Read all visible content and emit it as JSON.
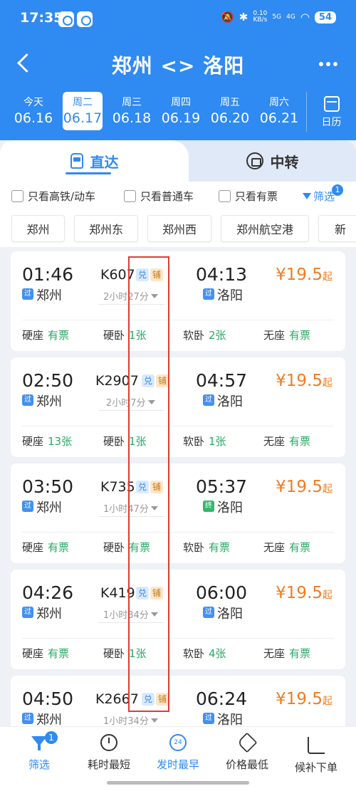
{
  "status_bar": {
    "time": "17:35",
    "net_speed": "0.10",
    "net_unit": "KB/s",
    "sig1": "5G",
    "sig2": "4G",
    "battery": "54"
  },
  "header": {
    "route": "郑州 <> 洛阳"
  },
  "dates": [
    {
      "dow": "今天",
      "date": "06.16"
    },
    {
      "dow": "周二",
      "date": "06.17"
    },
    {
      "dow": "周三",
      "date": "06.18"
    },
    {
      "dow": "周四",
      "date": "06.19"
    },
    {
      "dow": "周五",
      "date": "06.20"
    },
    {
      "dow": "周六",
      "date": "06.21"
    }
  ],
  "calendar_label": "日历",
  "tabs": {
    "direct": "直达",
    "transfer": "中转"
  },
  "filters": {
    "highspeed": "只看高铁/动车",
    "normal": "只看普通车",
    "available": "只看有票",
    "screen": "筛选",
    "screen_badge": "1"
  },
  "stations": [
    "郑州",
    "郑州东",
    "郑州西",
    "郑州航空港",
    "新"
  ],
  "trains": [
    {
      "dep_time": "01:46",
      "dep_tag": "过",
      "dep_station": "郑州",
      "train_no": "K607",
      "badge1": "兑",
      "badge2": "铺",
      "duration": "2小时27分",
      "arr_time": "04:13",
      "arr_tag": "过",
      "arr_station": "洛阳",
      "price_currency": "¥",
      "price": "19.5",
      "price_suffix": "起",
      "seats": [
        {
          "name": "硬座",
          "avail": "有票"
        },
        {
          "name": "硬卧",
          "avail": "1张"
        },
        {
          "name": "软卧",
          "avail": "2张"
        },
        {
          "name": "无座",
          "avail": "有票"
        }
      ]
    },
    {
      "dep_time": "02:50",
      "dep_tag": "过",
      "dep_station": "郑州",
      "train_no": "K2907",
      "badge1": "兑",
      "badge2": "铺",
      "duration": "2小时7分",
      "arr_time": "04:57",
      "arr_tag": "过",
      "arr_station": "洛阳",
      "price_currency": "¥",
      "price": "19.5",
      "price_suffix": "起",
      "seats": [
        {
          "name": "硬座",
          "avail": "13张"
        },
        {
          "name": "硬卧",
          "avail": "1张"
        },
        {
          "name": "软卧",
          "avail": "1张"
        },
        {
          "name": "无座",
          "avail": "有票"
        }
      ]
    },
    {
      "dep_time": "03:50",
      "dep_tag": "过",
      "dep_station": "郑州",
      "train_no": "K735",
      "badge1": "兑",
      "badge2": "铺",
      "duration": "1小时47分",
      "arr_time": "05:37",
      "arr_tag": "终",
      "arr_station": "洛阳",
      "price_currency": "¥",
      "price": "19.5",
      "price_suffix": "起",
      "seats": [
        {
          "name": "硬座",
          "avail": "有票"
        },
        {
          "name": "硬卧",
          "avail": "有票"
        },
        {
          "name": "软卧",
          "avail": "有票"
        },
        {
          "name": "无座",
          "avail": "有票"
        }
      ]
    },
    {
      "dep_time": "04:26",
      "dep_tag": "过",
      "dep_station": "郑州",
      "train_no": "K419",
      "badge1": "兑",
      "badge2": "铺",
      "duration": "1小时34分",
      "arr_time": "06:00",
      "arr_tag": "过",
      "arr_station": "洛阳",
      "price_currency": "¥",
      "price": "19.5",
      "price_suffix": "起",
      "seats": [
        {
          "name": "硬座",
          "avail": "有票"
        },
        {
          "name": "硬卧",
          "avail": "1张"
        },
        {
          "name": "软卧",
          "avail": "4张"
        },
        {
          "name": "无座",
          "avail": "有票"
        }
      ]
    },
    {
      "dep_time": "04:50",
      "dep_tag": "过",
      "dep_station": "郑州",
      "train_no": "K2667",
      "badge1": "兑",
      "badge2": "铺",
      "duration": "1小时34分",
      "arr_time": "06:24",
      "arr_tag": "过",
      "arr_station": "洛阳",
      "price_currency": "¥",
      "price": "19.5",
      "price_suffix": "起",
      "seats": []
    }
  ],
  "bottom_nav": [
    {
      "label": "筛选",
      "icon": "filter-icon",
      "badge": "1"
    },
    {
      "label": "耗时最短",
      "icon": "stopwatch-icon"
    },
    {
      "label": "发时最早",
      "icon": "clock-24-icon",
      "icon_text": "24"
    },
    {
      "label": "价格最低",
      "icon": "price-tag-icon"
    },
    {
      "label": "候补下单",
      "icon": "cart-icon"
    }
  ],
  "colors": {
    "primary": "#2f8af2",
    "price": "#f07c22",
    "available": "#2aa864",
    "highlight": "#e53935"
  }
}
